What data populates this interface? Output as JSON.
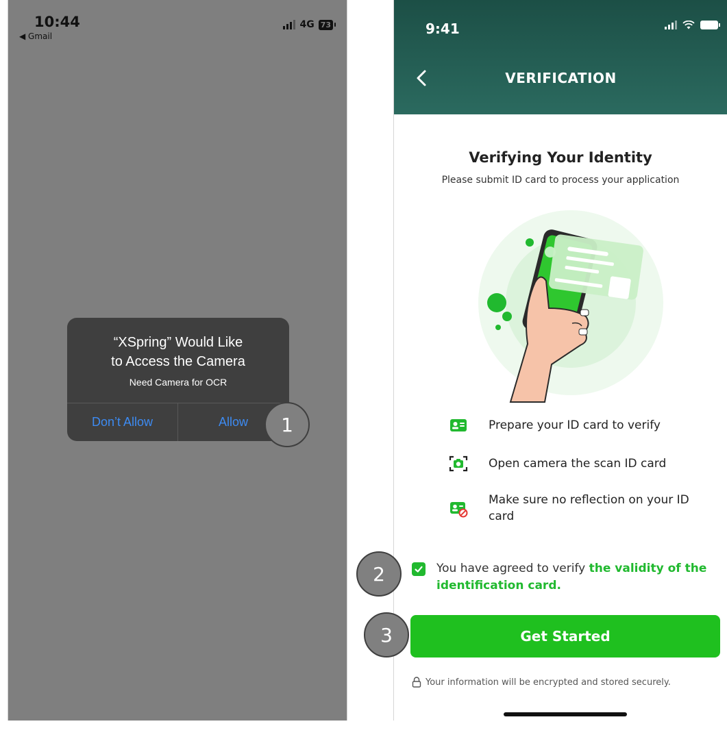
{
  "left_screen": {
    "status": {
      "time": "10:44",
      "back_app": "◀ Gmail",
      "network": "4G",
      "battery": "73"
    },
    "dialog": {
      "title_line1": "“XSpring” Would Like",
      "title_line2": "to Access the Camera",
      "message": "Need Camera for OCR",
      "deny_label": "Don’t Allow",
      "allow_label": "Allow"
    },
    "callout": "1"
  },
  "right_screen": {
    "status": {
      "time": "9:41"
    },
    "header": {
      "title": "VERIFICATION"
    },
    "heading": "Verifying Your Identity",
    "subheading": "Please submit ID card to process your application",
    "steps": [
      {
        "icon": "id-card-icon",
        "text": "Prepare your ID card to verify"
      },
      {
        "icon": "camera-scan-icon",
        "text": "Open camera the scan ID card"
      },
      {
        "icon": "no-reflection-icon",
        "text": "Make sure no reflection on your ID card"
      }
    ],
    "agreement": {
      "checked": true,
      "prefix": "You have agreed to verify ",
      "link": "the validity of the identification card."
    },
    "cta_label": "Get Started",
    "secure_note": "Your information will be encrypted and stored securely.",
    "callouts": [
      "2",
      "3"
    ]
  },
  "colors": {
    "accent_green": "#1fc01f",
    "header_teal": "#1c4f46",
    "ios_blue": "#3d8bf2",
    "dim_gray": "#7f7f7f"
  }
}
